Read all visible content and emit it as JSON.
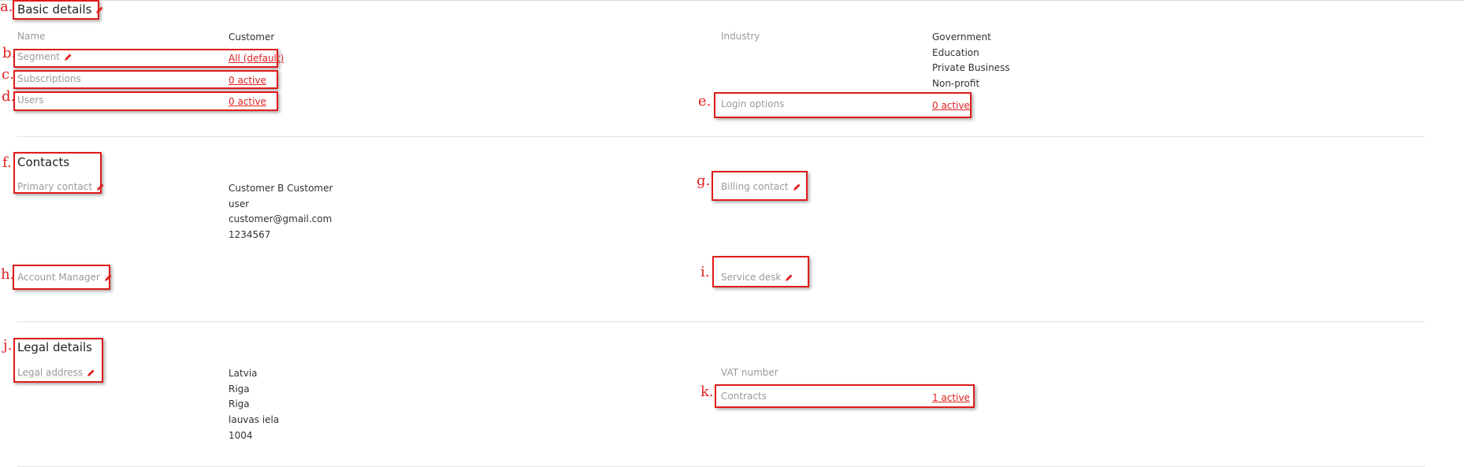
{
  "basic_details": {
    "title": "Basic details",
    "name_label": "Name",
    "name_value": "Customer",
    "segment_label": "Segment",
    "segment_value": "All (default)",
    "subscriptions_label": "Subscriptions",
    "subscriptions_value": "0 active",
    "users_label": "Users",
    "users_value": "0 active",
    "industry_label": "Industry",
    "industries": [
      "Government",
      "Education",
      "Private Business",
      "Non-profit"
    ],
    "login_options_label": "Login options",
    "login_options_value": "0 active"
  },
  "contacts": {
    "title": "Contacts",
    "primary_contact_label": "Primary contact",
    "primary_contact_lines": [
      "Customer B Customer",
      "user",
      "customer@gmail.com",
      "1234567"
    ],
    "billing_contact_label": "Billing contact",
    "account_manager_label": "Account Manager",
    "service_desk_label": "Service desk"
  },
  "legal_details": {
    "title": "Legal details",
    "legal_address_label": "Legal address",
    "legal_address_lines": [
      "Latvia",
      "Riga",
      "Riga",
      "lauvas iela",
      "1004"
    ],
    "vat_number_label": "VAT number",
    "contracts_label": "Contracts",
    "contracts_value": "1 active"
  },
  "annotation_markers": [
    "a.",
    "b.",
    "c.",
    "d.",
    "e.",
    "f.",
    "g.",
    "h.",
    "i.",
    "j.",
    "k."
  ],
  "colors": {
    "accent": "#e02020",
    "label_gray": "#9a9a9a",
    "text": "#333333"
  },
  "icons": {
    "edit": "pencil-icon"
  }
}
